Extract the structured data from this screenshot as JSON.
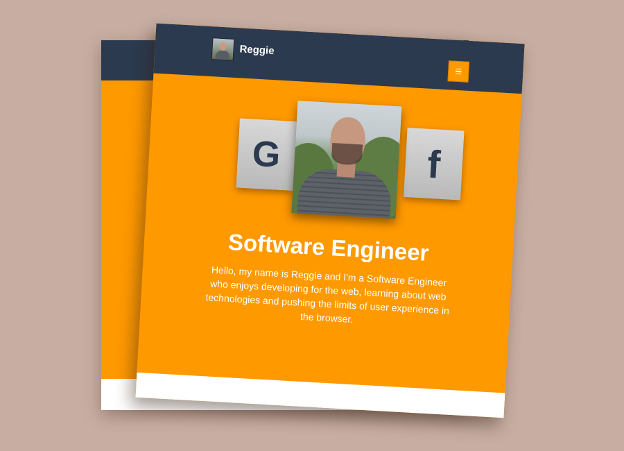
{
  "nav": {
    "name": "Reggie",
    "menu_icon": "hamburger-icon"
  },
  "gallery": {
    "left_tile": {
      "letter": "G",
      "icon": "google-icon"
    },
    "right_tile": {
      "letter": "f",
      "icon": "facebook-icon"
    }
  },
  "hero": {
    "title": "Software Engineer",
    "body": "Hello, my name is Reggie and I'm a Software Engineer who enjoys developing for the web, learning about web technologies and pushing the limits of user experience in the browser."
  },
  "colors": {
    "background": "#c8aea2",
    "navbar": "#2b3a4e",
    "accent": "#ff9900"
  }
}
